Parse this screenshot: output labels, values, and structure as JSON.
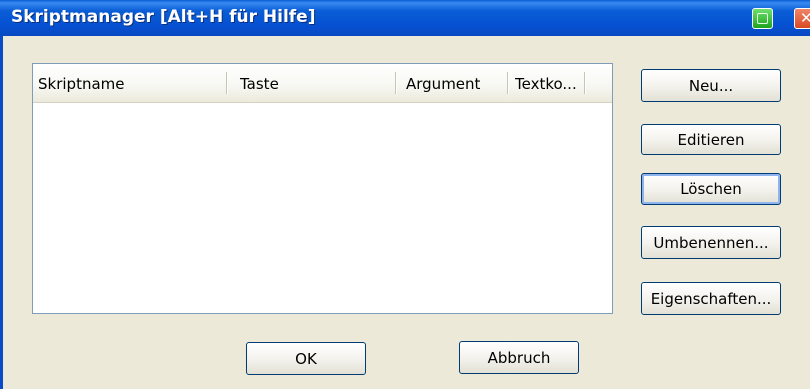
{
  "window": {
    "title": "Skriptmanager [Alt+H für Hilfe]",
    "close_glyph": "✕"
  },
  "listview": {
    "columns": [
      "Skriptname",
      "Taste",
      "Argument",
      "Textko..."
    ],
    "rows": []
  },
  "buttons": {
    "new": "Neu...",
    "edit": "Editieren",
    "delete": "Löschen",
    "rename": "Umbenennen...",
    "properties": "Eigenschaften...",
    "ok": "OK",
    "cancel": "Abbruch"
  },
  "colors": {
    "titlebar": "#0a5ed6",
    "face": "#ece9d8",
    "button_border": "#003c74"
  },
  "icons": {
    "titlebar_green": "app-status-icon",
    "titlebar_close": "close-icon"
  }
}
